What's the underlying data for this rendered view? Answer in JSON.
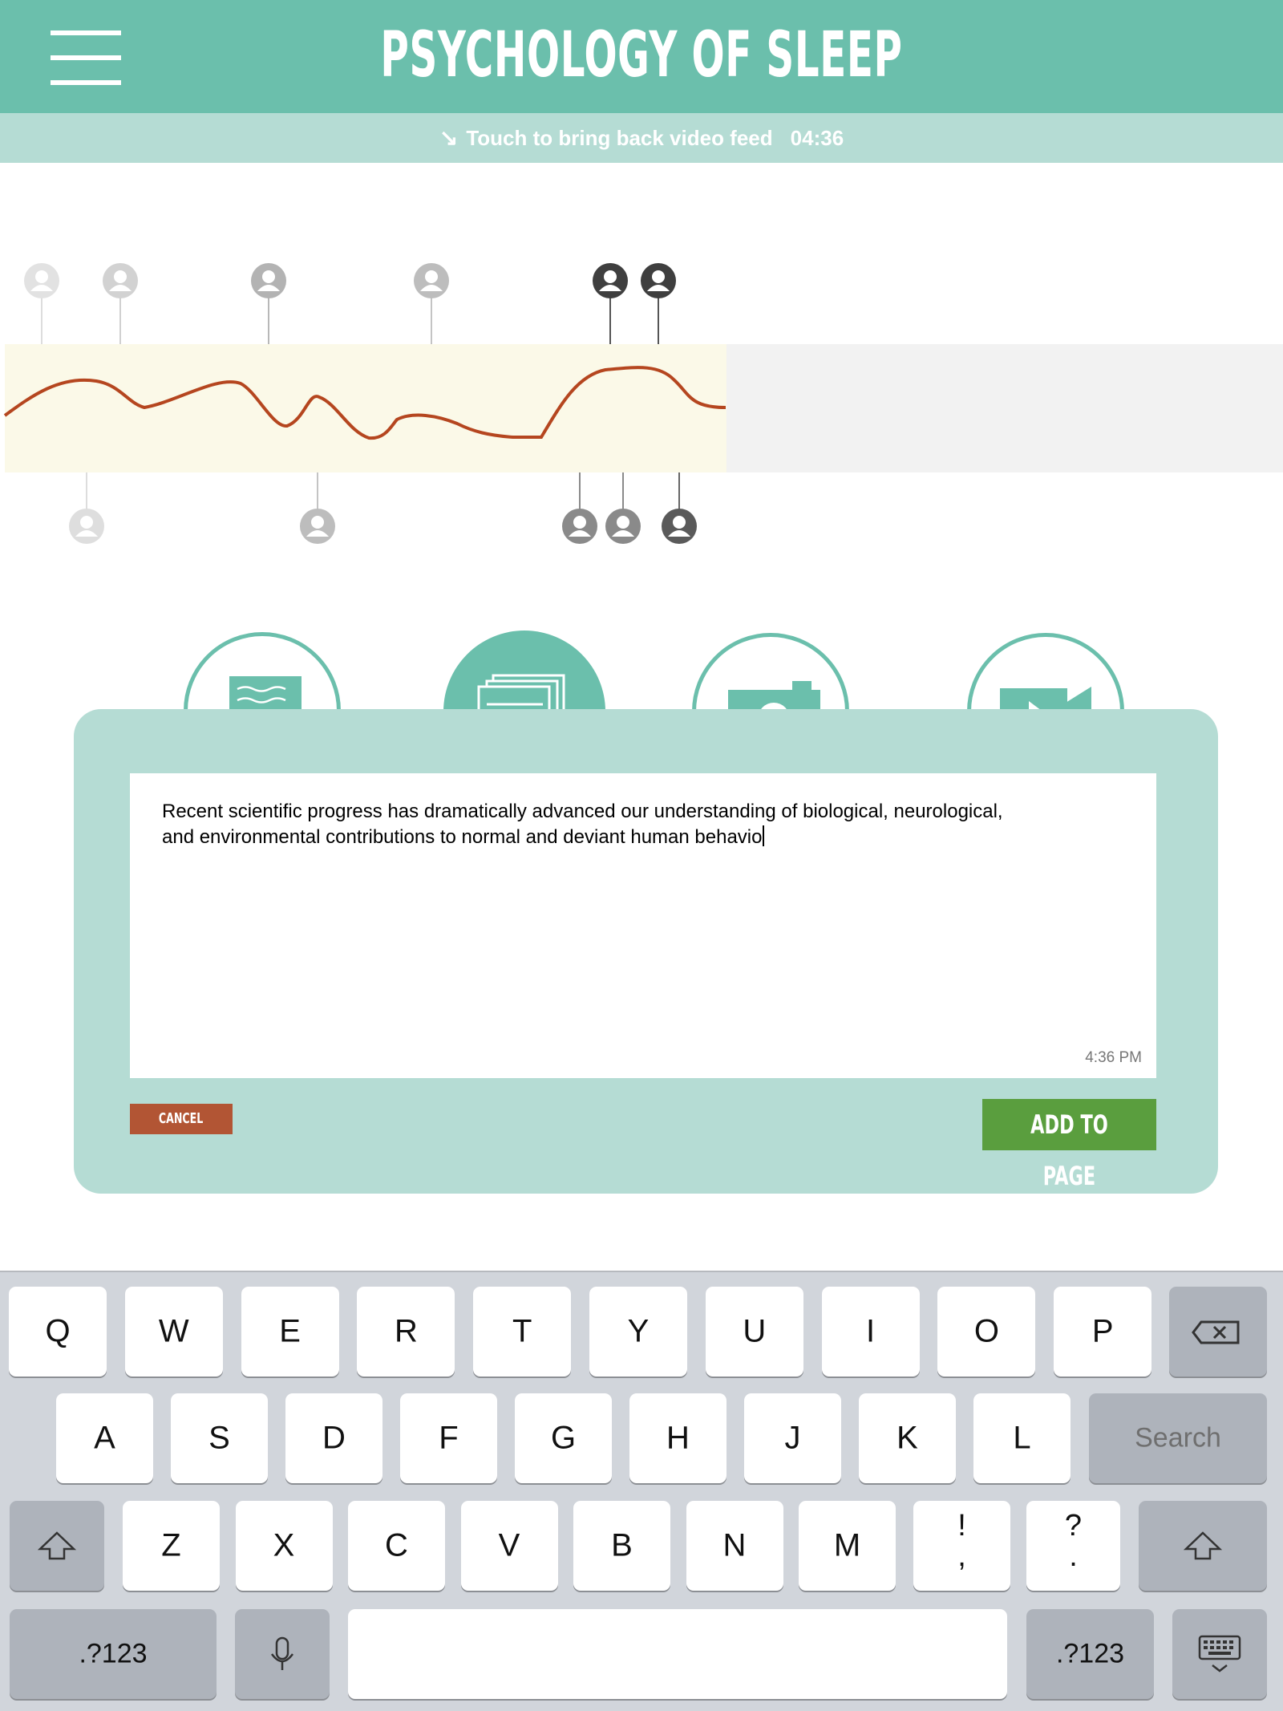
{
  "header": {
    "title": "PSYCHOLOGY OF SLEEP",
    "menu_icon": "hamburger-menu-icon",
    "background": "#6bbfac"
  },
  "feed_bar": {
    "arrow": "↘",
    "label": "Touch to bring back video feed",
    "time": "04:36"
  },
  "timeline": {
    "icon": "user-avatar-icon",
    "played_fraction": 0.566,
    "colors": {
      "curve": "#b5461f",
      "played_bg": "#fbf9e8",
      "unplayed_bg": "#f2f2f2"
    }
  },
  "tools": [
    {
      "name": "text-note",
      "icon": "text-note-icon",
      "active": false
    },
    {
      "name": "pages",
      "icon": "stacked-pages-icon",
      "active": true
    },
    {
      "name": "photo",
      "icon": "camera-icon",
      "active": false
    },
    {
      "name": "video",
      "icon": "video-camera-icon",
      "active": false
    }
  ],
  "compose": {
    "text_line1": "Recent scientific progress has dramatically advanced our understanding of biological, neurological,",
    "text_line2": "and environmental contributions to normal and deviant human behavio",
    "timestamp": "4:36 PM",
    "cancel_label": "CANCEL",
    "add_label": "ADD TO PAGE",
    "colors": {
      "panel": "#b5dcd4",
      "cancel": "#b25534",
      "add": "#5a9e3e"
    }
  },
  "keyboard": {
    "row1": [
      "Q",
      "W",
      "E",
      "R",
      "T",
      "Y",
      "U",
      "I",
      "O",
      "P"
    ],
    "row2": [
      "A",
      "S",
      "D",
      "F",
      "G",
      "H",
      "J",
      "K",
      "L"
    ],
    "row3": [
      "Z",
      "X",
      "C",
      "V",
      "B",
      "N",
      "M"
    ],
    "exclaim_top": "!",
    "exclaim_bottom": ",",
    "question_top": "?",
    "question_bottom": ".",
    "search_label": "Search",
    "numbers_label": ".?123",
    "backspace_icon": "backspace-icon",
    "shift_icon": "shift-icon",
    "mic_icon": "microphone-icon",
    "dismiss_icon": "keyboard-dismiss-icon"
  }
}
